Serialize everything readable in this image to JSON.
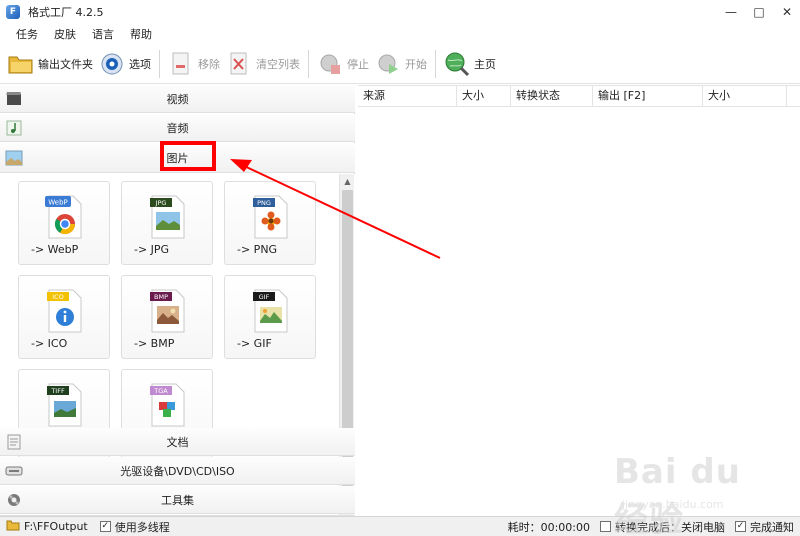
{
  "window": {
    "title": "格式工厂 4.2.5",
    "controls": [
      "—",
      "□",
      "✕"
    ]
  },
  "menu": [
    "任务",
    "皮肤",
    "语言",
    "帮助"
  ],
  "toolbar": {
    "output_folder": "输出文件夹",
    "options": "选项",
    "remove": "移除",
    "clear_list": "清空列表",
    "stop": "停止",
    "start": "开始",
    "home": "主页"
  },
  "categories": {
    "video": "视频",
    "audio": "音频",
    "picture": "图片",
    "document": "文档",
    "optical": "光驱设备\\DVD\\CD\\ISO",
    "tools": "工具集"
  },
  "formats": [
    {
      "badge": "WebP",
      "label": "-> WebP",
      "badge_color": "#3a7bd5"
    },
    {
      "badge": "JPG",
      "label": "-> JPG",
      "badge_color": "#2b4a1e"
    },
    {
      "badge": "PNG",
      "label": "-> PNG",
      "badge_color": "#2f5f9a"
    },
    {
      "badge": "ICO",
      "label": "-> ICO",
      "badge_color": "#f2c200"
    },
    {
      "badge": "BMP",
      "label": "-> BMP",
      "badge_color": "#6a1a4c"
    },
    {
      "badge": "GIF",
      "label": "-> GIF",
      "badge_color": "#1a1a1a"
    },
    {
      "badge": "TIFF",
      "label": "",
      "badge_color": "#1f3f1f"
    },
    {
      "badge": "TGA",
      "label": "",
      "badge_color": "#c08ad0"
    }
  ],
  "table_headers": [
    "来源",
    "大小",
    "转换状态",
    "输出 [F2]",
    "大小"
  ],
  "status": {
    "output_path": "F:\\FFOutput",
    "multithread": "使用多线程",
    "elapsed": "耗时：00:00:00",
    "after_done": "转换完成后：关闭电脑",
    "notify": "完成通知"
  },
  "watermark": {
    "brand": "Bai du 经验",
    "url": "jingyan.baidu.com"
  },
  "colors": {
    "annotation": "#ff0000",
    "accent": "#1b5fb8"
  }
}
